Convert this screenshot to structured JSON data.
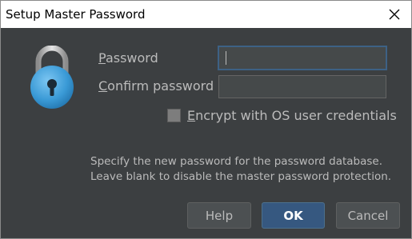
{
  "window": {
    "title": "Setup Master Password",
    "close_icon": "close-icon"
  },
  "form": {
    "password_label": "Password",
    "password_mnemonic": "P",
    "password_label_rest": "assword",
    "password_value": "",
    "confirm_label": "Confirm password",
    "confirm_mnemonic": "C",
    "confirm_label_rest": "onfirm password",
    "confirm_value": "",
    "encrypt_checkbox": {
      "label": "Encrypt with OS user credentials",
      "mnemonic": "E",
      "label_rest": "ncrypt with OS user credentials",
      "checked": false
    }
  },
  "help": {
    "line1": "Specify the new password for the password database.",
    "line2": "Leave blank to disable the master password protection."
  },
  "buttons": {
    "help": "Help",
    "ok": "OK",
    "cancel": "Cancel"
  },
  "icons": {
    "lock": "lock-icon"
  },
  "colors": {
    "background": "#3c3f41",
    "text": "#bbbbbb",
    "focus_border": "#3d6185",
    "ok_button": "#365880"
  }
}
